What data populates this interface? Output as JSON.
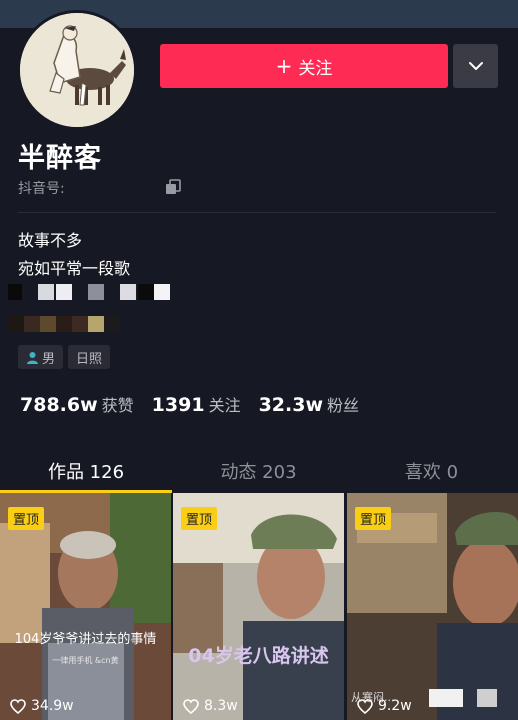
{
  "header": {
    "follow_label": "关注",
    "follow_plus": "+"
  },
  "profile": {
    "nickname": "半醉客",
    "douyin_id_label": "抖音号:",
    "bio": [
      "故事不多",
      "宛如平常一段歌"
    ],
    "tags": [
      {
        "icon": "male-icon",
        "label": "男"
      },
      {
        "label": "日照"
      }
    ],
    "stats": [
      {
        "value": "788.6w",
        "label": "获赞"
      },
      {
        "value": "1391",
        "label": "关注"
      },
      {
        "value": "32.3w",
        "label": "粉丝"
      }
    ]
  },
  "tabs": [
    {
      "label": "作品 126",
      "active": true
    },
    {
      "label": "动态 203",
      "active": false
    },
    {
      "label": "喜欢 0",
      "active": false
    }
  ],
  "videos": [
    {
      "pinned": "置顶",
      "caption": "104岁爷爷讲过去的事情",
      "subcaption": "一律用手机 &cn黄",
      "likes": "34.9w"
    },
    {
      "pinned": "置顶",
      "caption": "04岁老八路讲述",
      "likes": "8.3w"
    },
    {
      "pinned": "置顶",
      "caption": "从寒闷...",
      "likes": "9.2w"
    }
  ],
  "colors": {
    "accent": "#fe2c55",
    "tab_indicator": "#face15",
    "background": "#161823"
  }
}
